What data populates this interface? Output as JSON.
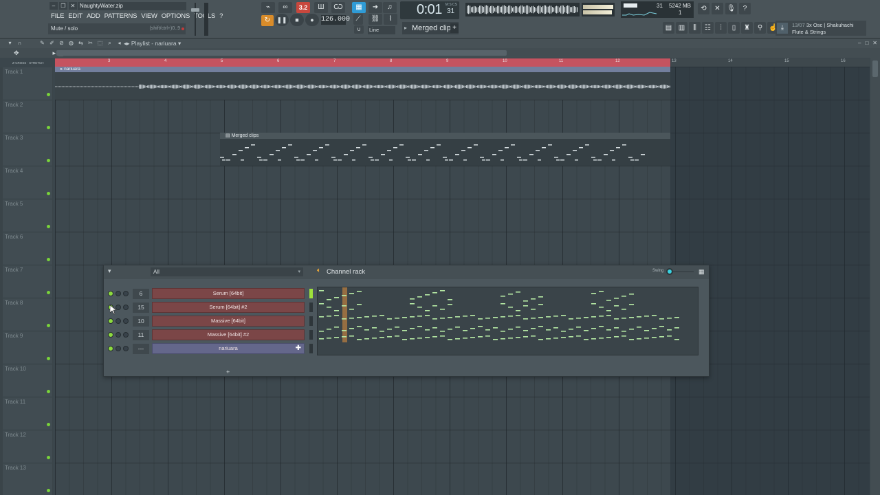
{
  "window": {
    "project_title": "NaughtyWater.zip",
    "menu": [
      "FILE",
      "EDIT",
      "ADD",
      "PATTERNS",
      "VIEW",
      "OPTIONS",
      "TOOLS",
      "?"
    ],
    "hint_text": "Mute / solo",
    "hint_shortcut": "(shift/ctrl+)0..9"
  },
  "transport": {
    "song_pos_text": "0:01",
    "song_pos_sub": "31",
    "time_unit": "M:S:CS",
    "tempo": "126.000",
    "pattern_mode_label": "3.2",
    "snap": "Line",
    "pattern_selector": "Merged clips",
    "cpu_value": "31",
    "memory": "5242 MB",
    "polyphony": "1"
  },
  "news": {
    "date": "13/07",
    "line1": "3x Osc | Shakuhachi",
    "line2": "Flute & Strings"
  },
  "playlist": {
    "title": "Playlist - nariuara",
    "ruler_bars": [
      "3",
      "4",
      "5",
      "6",
      "7",
      "8",
      "9",
      "10",
      "11",
      "12",
      "13",
      "14",
      "15",
      "16"
    ],
    "tracks": [
      "Track 1",
      "Track 2",
      "Track 3",
      "Track 4",
      "Track 5",
      "Track 6",
      "Track 7",
      "Track 8",
      "Track 9",
      "Track 10",
      "Track 11",
      "Track 12",
      "Track 13"
    ],
    "audio_clip_name": "nariuara",
    "pattern_clip_name": "Merged clips",
    "side_labels": [
      "Z-CROSS",
      "STRETCH"
    ]
  },
  "channel_rack": {
    "title": "Channel rack",
    "filter": "All",
    "swing_label": "Swing",
    "add_label": "+",
    "channels": [
      {
        "num": "6",
        "name": "Serum [64bit]",
        "type": "plugin",
        "active_meter": true
      },
      {
        "num": "15",
        "name": "Serum [64bit] #2",
        "type": "plugin",
        "active_meter": false
      },
      {
        "num": "10",
        "name": "Massive [64bit]",
        "type": "plugin",
        "active_meter": false
      },
      {
        "num": "11",
        "name": "Massive [64bit] #2",
        "type": "plugin",
        "active_meter": false
      },
      {
        "num": "---",
        "name": "nariuara",
        "type": "sampler",
        "active_meter": false
      }
    ]
  },
  "colors": {
    "accent_green": "#8ddb3f",
    "loop_region": "#c55360",
    "plugin_channel": "#7b4647",
    "sampler_channel": "#64678b",
    "audio_clip_header": "#737f9e",
    "pattern_mode": "#c8473d",
    "tool_blue": "#2f9bd6",
    "tool_orange": "#d98c2a"
  },
  "icons": [
    "settings-icon",
    "plugin-icon",
    "mic-icon",
    "help-icon",
    "playlist-icon",
    "piano-roll-icon",
    "mixer-icon",
    "channel-rack-icon",
    "browser-icon",
    "download-icon"
  ]
}
